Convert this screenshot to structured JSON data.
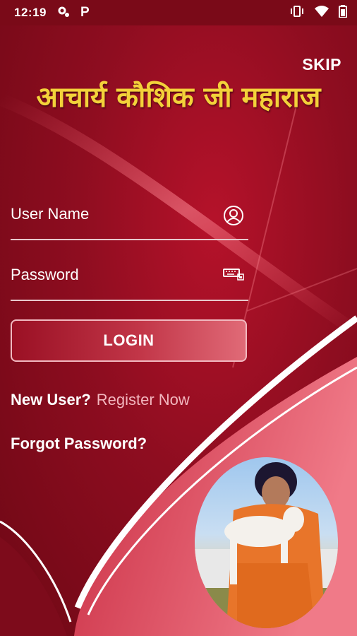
{
  "status_bar": {
    "time": "12:19",
    "left_icons": [
      "settings-icon",
      "parking-icon"
    ],
    "right_icons": [
      "vibrate-icon",
      "wifi-icon",
      "battery-icon"
    ]
  },
  "header": {
    "skip_label": "SKIP",
    "title": "आचार्य कौशिक जी महाराज"
  },
  "form": {
    "username_label": "User Name",
    "username_icon": "user-icon",
    "password_label": "Password",
    "password_icon": "keyboard-icon",
    "login_label": "LOGIN"
  },
  "links": {
    "new_user_label": "New User?",
    "register_label": "Register Now",
    "forgot_label": "Forgot Password?"
  },
  "colors": {
    "background": "#8e0d20",
    "title": "#f3d23a",
    "register_link": "#f2b6be",
    "button_gradient_end": "#e06a77"
  }
}
